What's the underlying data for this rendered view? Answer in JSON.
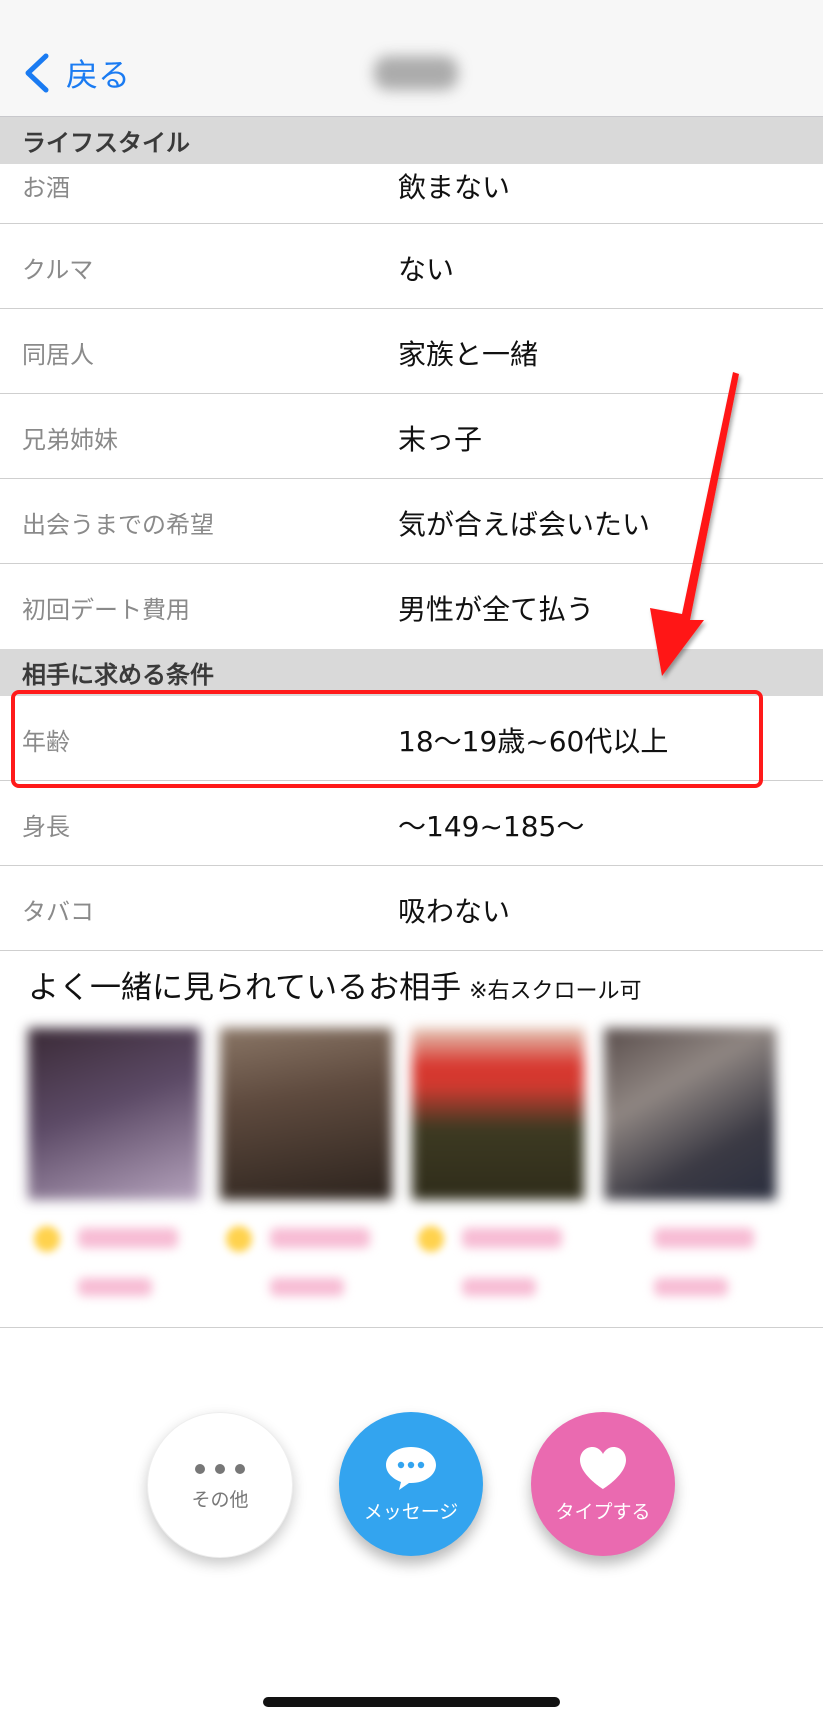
{
  "navbar": {
    "back_label": "戻る"
  },
  "lifestyle": {
    "header": "ライフスタイル",
    "rows": [
      {
        "key": "お酒",
        "value": "飲まない"
      },
      {
        "key": "クルマ",
        "value": "ない"
      },
      {
        "key": "同居人",
        "value": "家族と一緒"
      },
      {
        "key": "兄弟姉妹",
        "value": "末っ子"
      },
      {
        "key": "出会うまでの希望",
        "value": "気が合えば会いたい"
      },
      {
        "key": "初回デート費用",
        "value": "男性が全て払う"
      }
    ]
  },
  "conditions": {
    "header": "相手に求める条件",
    "rows": [
      {
        "key": "年齢",
        "value": "18～19歳~60代以上"
      },
      {
        "key": "身長",
        "value": "～149~185～"
      },
      {
        "key": "タバコ",
        "value": "吸わない"
      }
    ]
  },
  "recommend": {
    "title": "よく一緒に見られているお相手",
    "note": "※右スクロール可"
  },
  "actions": {
    "more_label": "その他",
    "message_label": "メッセージ",
    "like_label": "タイプする"
  },
  "colors": {
    "accent_blue": "#1a7bf2",
    "message_blue": "#33a4ef",
    "like_pink": "#ea6ab0",
    "highlight_red": "#ff1a1a"
  },
  "icons": {
    "back": "chevron-left-icon",
    "more": "ellipsis-icon",
    "message": "speech-bubble-icon",
    "like": "heart-icon"
  }
}
